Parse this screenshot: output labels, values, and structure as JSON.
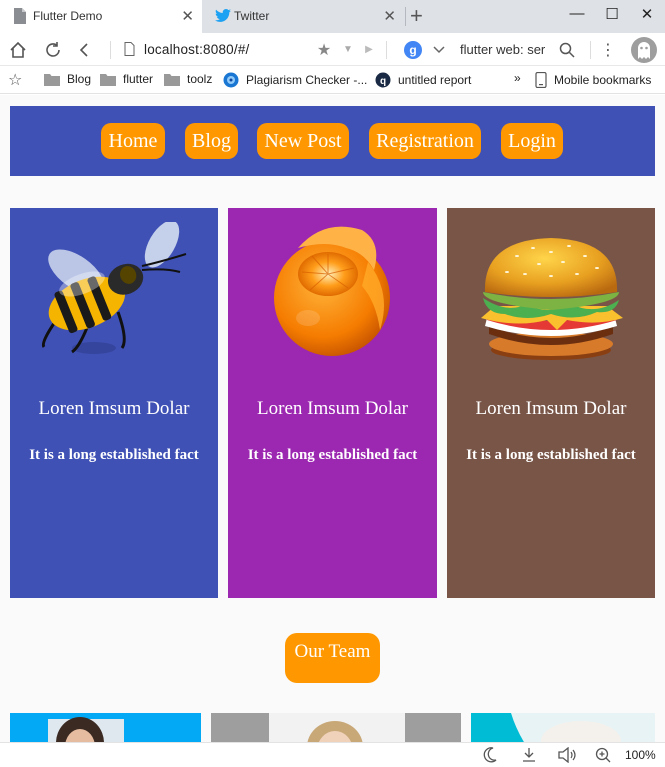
{
  "browser": {
    "tabs": [
      {
        "title": "Flutter Demo",
        "icon": "page-icon"
      },
      {
        "title": "Twitter",
        "icon": "twitter-bird-icon"
      }
    ],
    "url": "localhost:8080/#/",
    "search_text": "flutter web: ser",
    "bookmarks": [
      "Blog",
      "flutter",
      "toolz",
      "Plagiarism Checker -...",
      "untitled report"
    ],
    "overflow_symbol": "»",
    "mobile_bookmarks": "Mobile bookmarks",
    "zoom": "100%"
  },
  "nav": {
    "items": [
      "Home",
      "Blog",
      "New Post",
      "Registration",
      "Login"
    ]
  },
  "cards": [
    {
      "image": "bee-image",
      "title": "Loren Imsum Dolar",
      "text": "It is a long established fact",
      "color": "#3f51b5"
    },
    {
      "image": "orange-image",
      "title": "Loren Imsum Dolar",
      "text": "It is a long established fact",
      "color": "#9c27b0"
    },
    {
      "image": "burger-image",
      "title": "Loren Imsum Dolar",
      "text": "It is a long established fact",
      "color": "#795548"
    }
  ],
  "team": {
    "button_label": "Our Team",
    "members": [
      {
        "image": "person-photo",
        "color": "#03a9f4"
      },
      {
        "image": "person-photo",
        "color": "#9e9e9e"
      },
      {
        "image": "person-photo",
        "color": "#00bcd4"
      }
    ]
  },
  "colors": {
    "accent": "#ff9800",
    "nav": "#3f51b5"
  }
}
